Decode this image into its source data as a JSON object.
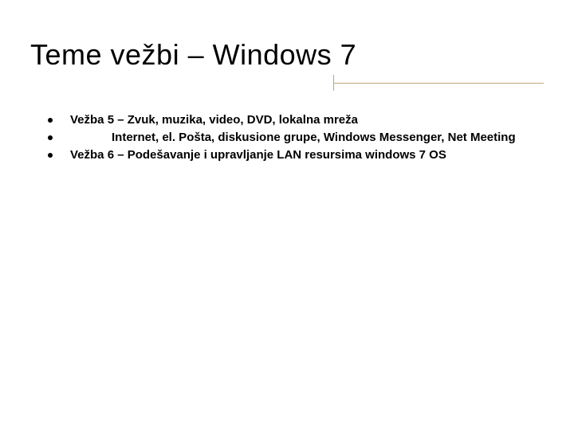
{
  "title": "Teme vežbi – Windows 7",
  "items": [
    {
      "text": "Vežba 5 – Zvuk, muzika, video, DVD, lokalna mreža"
    },
    {
      "text": "Internet, el. Pošta, diskusione grupe, Windows Messenger, Net Meeting",
      "indent": true
    },
    {
      "text": "Vežba 6 – Podešavanje i upravljanje LAN resursima windows 7 OS"
    }
  ]
}
